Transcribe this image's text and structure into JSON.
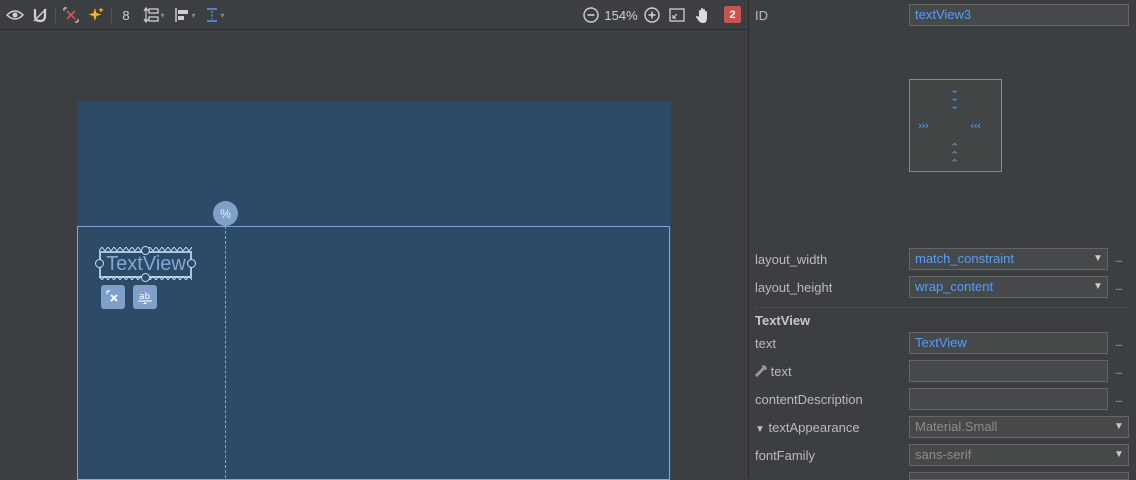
{
  "toolbar": {
    "margin_value": "8",
    "zoom_level": "154%",
    "error_count": "2",
    "error_color": "#c75450"
  },
  "canvas": {
    "guideline_badge": "%",
    "textview_label": "TextView",
    "blueprint_color": "#2d4a67",
    "outline_color": "#7fa8d8"
  },
  "attributes": {
    "id_label": "ID",
    "id_value": "textView3",
    "layout_width_label": "layout_width",
    "layout_width_value": "match_constraint",
    "layout_height_label": "layout_height",
    "layout_height_value": "wrap_content",
    "section_title": "TextView",
    "text_label": "text",
    "text_value": "TextView",
    "tools_text_label": "text",
    "tools_text_value": "",
    "content_description_label": "contentDescription",
    "content_description_value": "",
    "text_appearance_label": "textAppearance",
    "text_appearance_value": "Material.Small",
    "font_family_label": "fontFamily",
    "font_family_value": "sans-serif",
    "more_button": "...",
    "accent_color": "#589df6"
  },
  "constraint_widget": {
    "top": "⌄⌄⌄",
    "bottom": "⌃⌃⌃",
    "left": "›››",
    "right": "‹‹‹"
  },
  "icons": [
    "eye-icon",
    "magnet-icon",
    "clear-constraints-icon",
    "infer-constraints-icon",
    "margin-icon",
    "pack-icon",
    "align-icon",
    "guidelines-icon",
    "zoom-out-icon",
    "zoom-in-icon",
    "zoom-fit-icon",
    "pan-hand-icon",
    "error-badge"
  ]
}
